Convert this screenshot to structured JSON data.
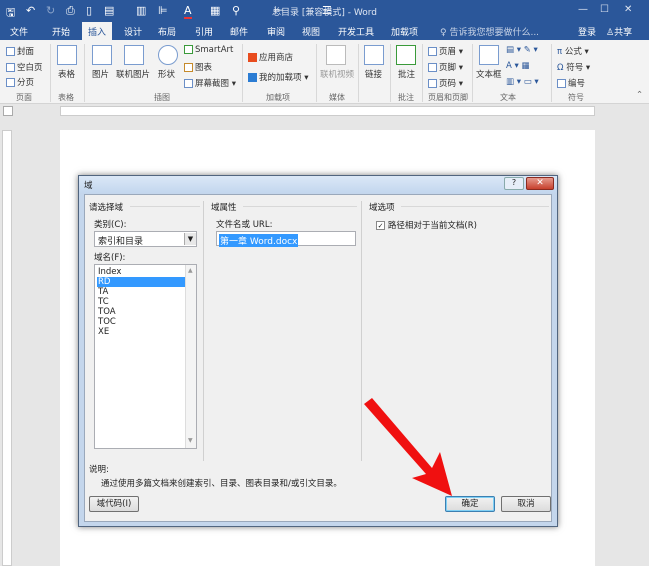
{
  "window": {
    "title": "总目录 [兼容模式] - Word"
  },
  "tabs": [
    "文件",
    "开始",
    "插入",
    "设计",
    "布局",
    "引用",
    "邮件",
    "审阅",
    "视图",
    "开发工具",
    "加载项"
  ],
  "active_tab": "插入",
  "tell_me": "告诉我您想要做什么...",
  "account": {
    "login": "登录",
    "share": "共享"
  },
  "ribbon": {
    "page": {
      "items": [
        "封面",
        "空白页",
        "分页"
      ],
      "label": "页面"
    },
    "table": {
      "items": [
        "表格"
      ],
      "label": "表格"
    },
    "illustrations": {
      "items": [
        "图片",
        "联机图片",
        "形状",
        "SmartArt",
        "图表",
        "屏幕截图"
      ],
      "label": "插图"
    },
    "addins": {
      "items": [
        "应用商店",
        "我的加载项"
      ],
      "label": "加载项"
    },
    "media": {
      "items": [
        "联机视频"
      ],
      "label": "媒体"
    },
    "links": {
      "items": [
        "链接"
      ],
      "label": ""
    },
    "comments": {
      "items": [
        "批注"
      ],
      "label": "批注"
    },
    "header_footer": {
      "items": [
        "页眉",
        "页脚",
        "页码"
      ],
      "label": "页眉和页脚"
    },
    "text": {
      "items": [
        "文本框"
      ],
      "label": "文本"
    },
    "symbols": {
      "items": [
        "公式",
        "符号",
        "编号"
      ],
      "label": "符号"
    }
  },
  "dialog": {
    "title": "域",
    "help": "?",
    "select_group": "请选择域",
    "category_label": "类别(C):",
    "category_value": "索引和目录",
    "field_names_label": "域名(F):",
    "field_names": [
      "Index",
      "RD",
      "TA",
      "TC",
      "TOA",
      "TOC",
      "XE"
    ],
    "selected_field": "RD",
    "props_group": "域属性",
    "filename_label": "文件名或 URL:",
    "filename_value": "第一章 Word.docx",
    "options_group": "域选项",
    "relative_path": "路径相对于当前文档(R)",
    "relative_path_checked": true,
    "desc_label": "说明:",
    "desc_text": "通过使用多篇文档来创建索引、目录、图表目录和/或引文目录。",
    "field_codes_btn": "域代码(I)",
    "ok_btn": "确定",
    "cancel_btn": "取消"
  }
}
